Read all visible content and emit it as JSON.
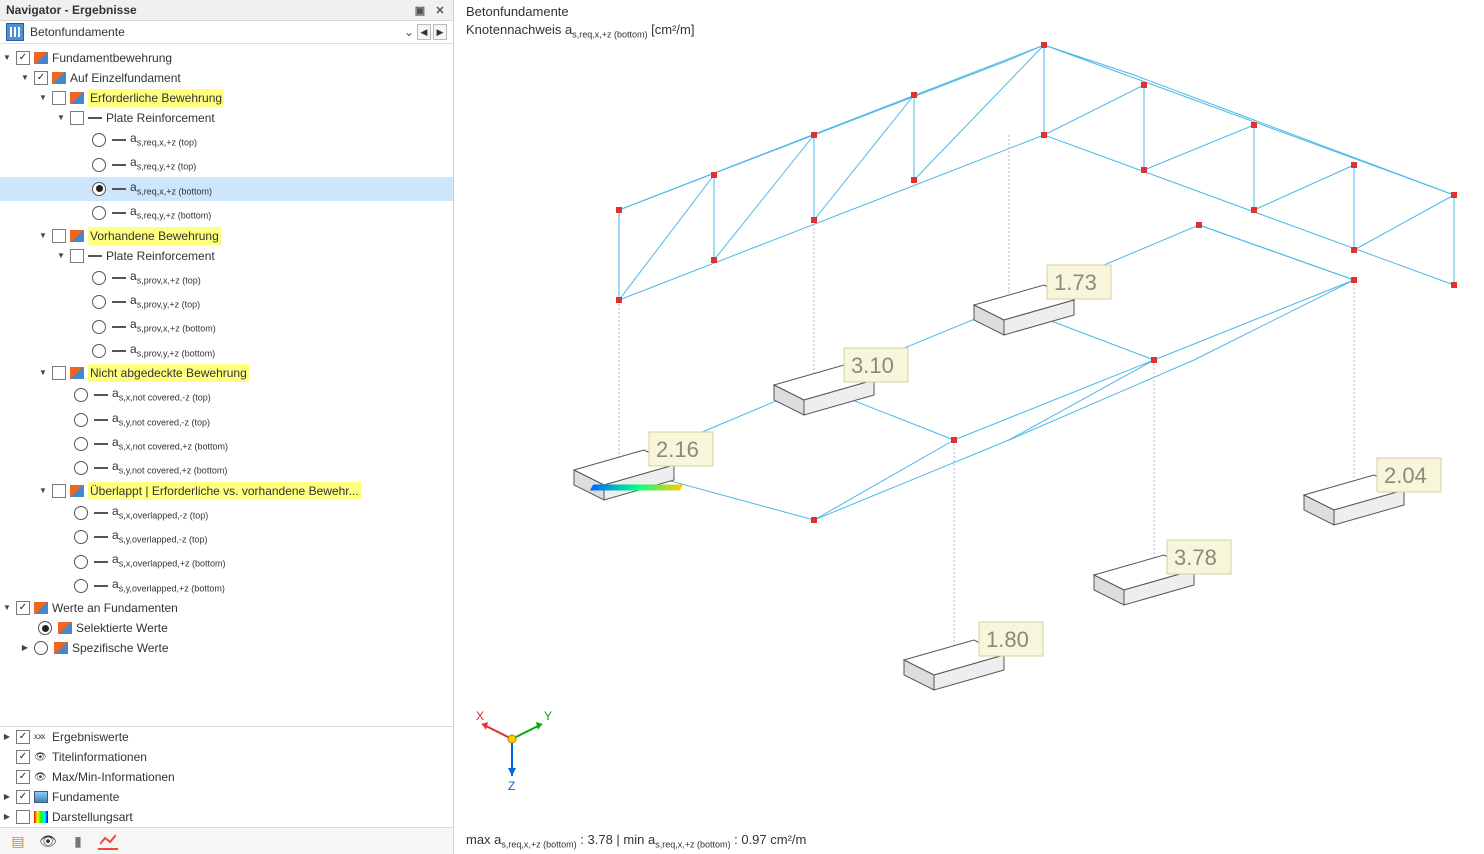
{
  "panel": {
    "title": "Navigator - Ergebnisse",
    "module": "Betonfundamente"
  },
  "tree": {
    "root": "Fundamentbewehrung",
    "auf_einzel": "Auf Einzelfundament",
    "erforderlich": "Erforderliche Bewehrung",
    "plate1": "Plate Reinforcement",
    "r_top_x": "a",
    "r_top_x_suf": "s,req,x,+z (top)",
    "r_top_y": "a",
    "r_top_y_suf": "s,req,y,+z (top)",
    "r_bot_x": "a",
    "r_bot_x_suf": "s,req,x,+z (bottom)",
    "r_bot_y": "a",
    "r_bot_y_suf": "s,req,y,+z (bottom)",
    "vorhanden": "Vorhandene Bewehrung",
    "plate2": "Plate Reinforcement",
    "p_top_x_suf": "s,prov,x,+z (top)",
    "p_top_y_suf": "s,prov,y,+z (top)",
    "p_bot_x_suf": "s,prov,x,+z (bottom)",
    "p_bot_y_suf": "s,prov,y,+z (bottom)",
    "nicht_abg": "Nicht abgedeckte Bewehrung",
    "nc_x_neg_top": "s,x,not covered,-z (top)",
    "nc_y_neg_top": "s,y,not covered,-z (top)",
    "nc_x_pos_bot": "s,x,not covered,+z (bottom)",
    "nc_y_pos_bot": "s,y,not covered,+z (bottom)",
    "ueberlappt": "Überlappt | Erforderliche vs. vorhandene Bewehr...",
    "ov_x_neg_top": "s,x,overlapped,-z (top)",
    "ov_y_neg_top": "s,y,overlapped,-z (top)",
    "ov_x_pos_bot": "s,x,overlapped,+z (bottom)",
    "ov_y_pos_bot": "s,y,overlapped,+z (bottom)",
    "werte_fund": "Werte an Fundamenten",
    "sel_werte": "Selektierte Werte",
    "spez_werte": "Spezifische Werte",
    "ergebniswerte": "Ergebniswerte",
    "titelinfo": "Titelinformationen",
    "maxmin": "Max/Min-Informationen",
    "fundamente": "Fundamente",
    "darstellung": "Darstellungsart"
  },
  "viewport": {
    "title": "Betonfundamente",
    "subtitle_prefix": "Knotennachweis a",
    "subtitle_sub": "s,req,x,+z (bottom)",
    "subtitle_unit": " [cm²/m]",
    "labels": {
      "v1": "2.16",
      "v2": "3.10",
      "v3": "1.73",
      "v4": "1.80",
      "v5": "3.78",
      "v6": "2.04"
    },
    "status_max": "max a",
    "status_max_sub": "s,req,x,+z (bottom)",
    "status_max_val": " : 3.78 | min a",
    "status_min_sub": "s,req,x,+z (bottom)",
    "status_min_val": " : 0.97 cm²/m",
    "axes": {
      "x": "X",
      "y": "Y",
      "z": "Z"
    }
  }
}
